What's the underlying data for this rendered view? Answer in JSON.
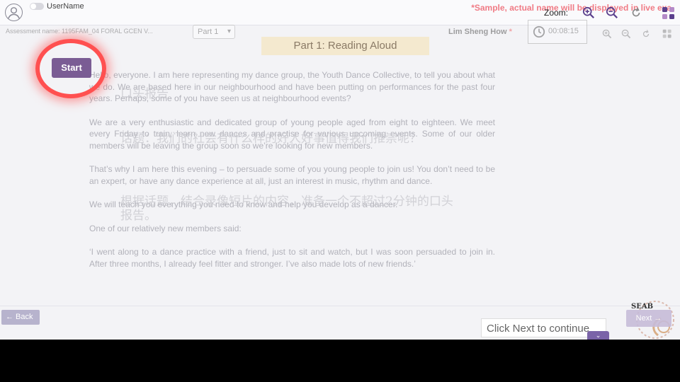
{
  "header": {
    "username": "UserName",
    "sample_note": "*Sample, actual name will be displayed in live exa",
    "zoom_label": "Zoom:"
  },
  "ghost_header": {
    "assessment_name": "Assessment name: 1195FAM_04 FORAL GCEN V...",
    "part_selected": "Part 1",
    "candidate_name": "Lim Sheng How",
    "candidate_marker": "*",
    "timer": "00:08:15"
  },
  "content": {
    "part_title": "Part 1: Reading Aloud",
    "paragraphs": [
      "Hello, everyone. I am here representing my dance group, the Youth Dance Collective, to tell you about what we do. We are based here in our neighbourhood and have been putting on performances for the past four years. Perhaps, some of you have seen us at neighbourhood events?",
      "We are a very enthusiastic and dedicated group of young people aged from eight to eighteen. We meet every Friday to train, learn new dances and practise for various upcoming events. Some of our older members will be leaving the group soon so we’re looking for new members.",
      "That’s why I am here this evening – to persuade some of you young people to join us! You don’t need to be an expert, or have any dance experience at all, just an interest in music, rhythm and dance.",
      "We will teach you everything you need to know and help you develop as a dancer.",
      "One of our relatively new members said:",
      "‘I went along to a dance practice with a friend, just to sit and watch, but I was soon persuaded to join in. After three months, I already feel fitter and stronger. I’ve also made lots of new friends.’"
    ],
    "overlay_chinese": {
      "line1": "口头报告",
      "line2": "话题：我们的社会有什么样的好人好事值得我们推崇呢？",
      "line3": "根据话题，结合录像短片的内容，准备一个不超过2分钟的口头报告。"
    }
  },
  "start_button": "Start",
  "footer": {
    "back_label": "← Back",
    "next_hint": "Click Next to continue",
    "next_label": "Next →",
    "chevron": "⌄",
    "logo_text": "SEAB"
  },
  "colors": {
    "accent": "#7a5c94",
    "highlight_ring": "#ff5050",
    "sample_note": "#f07b85",
    "part_title_bg": "#f4e9cf"
  }
}
